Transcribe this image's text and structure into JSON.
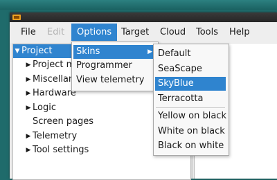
{
  "menubar": {
    "file": "File",
    "edit": "Edit",
    "options": "Options",
    "target": "Target",
    "cloud": "Cloud",
    "tools": "Tools",
    "help": "Help"
  },
  "tree": {
    "root": "Project",
    "items": [
      {
        "label": "Project m",
        "expandable": true
      },
      {
        "label": "Miscellan",
        "expandable": true
      },
      {
        "label": "Hardware",
        "expandable": true
      },
      {
        "label": "Logic",
        "expandable": true
      },
      {
        "label": "Screen pages",
        "expandable": false
      },
      {
        "label": "Telemetry",
        "expandable": true
      },
      {
        "label": "Tool settings",
        "expandable": true
      }
    ]
  },
  "options_menu": {
    "items": [
      "Skins",
      "Programmer",
      "View telemetry"
    ]
  },
  "skins_menu": {
    "items": [
      "Default",
      "SeaScape",
      "SkyBlue",
      "Terracotta",
      "Yellow on black",
      "White on black",
      "Black on white"
    ],
    "highlighted": "SkyBlue"
  },
  "icons": {
    "expanded": "triangle-down-icon",
    "collapsed": "triangle-right-icon",
    "submenu": "chevron-right-icon"
  },
  "colors": {
    "accent": "#2f84cf",
    "desktop": "#1f6b6b"
  }
}
